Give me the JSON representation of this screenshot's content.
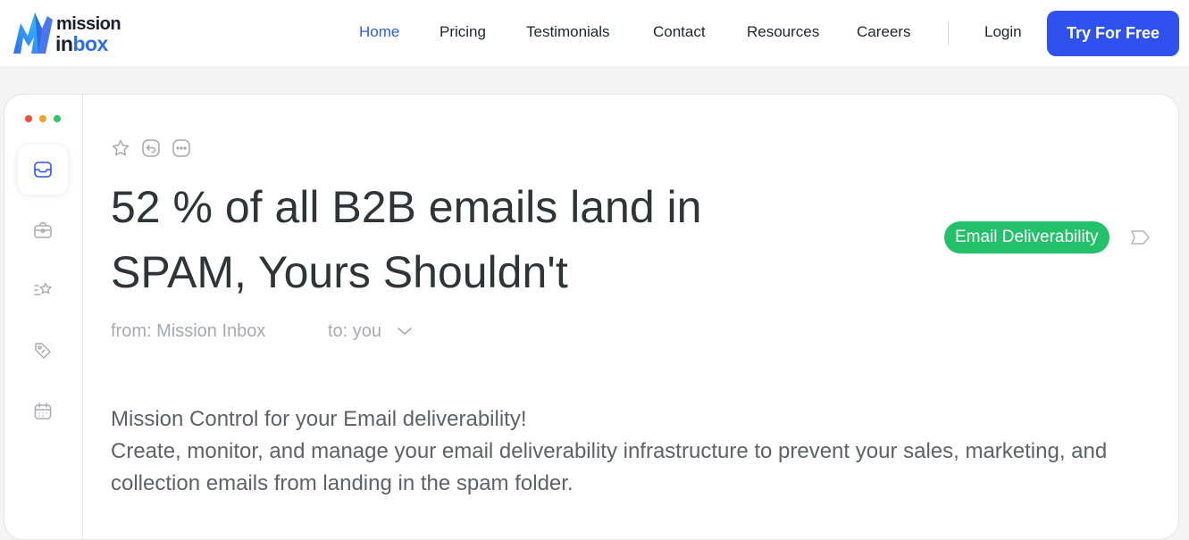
{
  "brand": {
    "line1": "mission",
    "line2_prefix": "in",
    "line2_accent": "box",
    "colors": {
      "primary": "#2f52ef",
      "accent": "#2d6cf2",
      "tag": "#22c16a"
    }
  },
  "nav": {
    "items": [
      {
        "label": "Home",
        "active": true
      },
      {
        "label": "Pricing"
      },
      {
        "label": "Testimonials"
      },
      {
        "label": "Contact"
      },
      {
        "label": "Resources"
      },
      {
        "label": "Careers"
      }
    ],
    "login": "Login",
    "cta": "Try For Free"
  },
  "window_dots": [
    "#ee4f3e",
    "#f2a227",
    "#2cc56a"
  ],
  "sidebar_icons": [
    "inbox-icon",
    "briefcase-icon",
    "starred-list-icon",
    "tag-icon",
    "calendar-icon"
  ],
  "toolbar_icons": [
    "star-icon",
    "reply-icon",
    "more-icon"
  ],
  "email": {
    "subject_line1": "52 % of all B2B emails land in",
    "subject_line2": "SPAM, Yours Shouldn't",
    "tag": "Email Deliverability",
    "from": "from: Mission Inbox",
    "to": "to: you",
    "body_line1": "Mission Control for your Email deliverability!",
    "body_line2": "Create, monitor, and manage your email deliverability infrastructure to prevent your sales, marketing, and collection emails from landing in the spam folder."
  }
}
